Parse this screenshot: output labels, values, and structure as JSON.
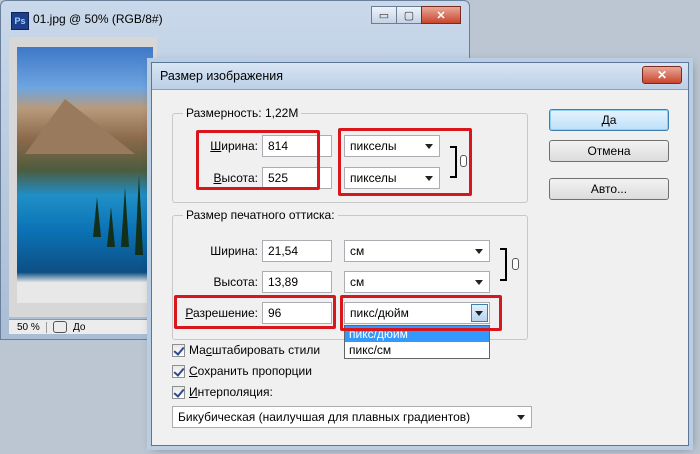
{
  "document_window": {
    "ps_icon": "Ps",
    "title": "01.jpg @ 50% (RGB/8#)",
    "buttons": {
      "minimize": "▭",
      "maximize": "▢",
      "close": "✕"
    },
    "status": {
      "zoom": "50 %",
      "doc_text": "До"
    }
  },
  "dialog": {
    "title": "Размер изображения",
    "close_label": "✕",
    "pixel_dimensions": {
      "prefix": "Размерность: ",
      "value": "1,22M",
      "width_label_u": "Ш",
      "width_label_rest": "ирина:",
      "width_value": "814",
      "width_unit": "пикселы",
      "height_label_u": "В",
      "height_label_rest": "ысота:",
      "height_value": "525",
      "height_unit": "пикселы"
    },
    "document_size": {
      "title": "Размер печатного оттиска:",
      "width_label": "Ширина:",
      "width_value": "21,54",
      "width_unit": "см",
      "height_label": "Высота:",
      "height_value": "13,89",
      "height_unit": "см",
      "resolution_label_u": "Р",
      "resolution_label_rest": "азрешение:",
      "resolution_value": "96",
      "resolution_unit": "пикс/дюйм",
      "resolution_options": [
        "пикс/дюйм",
        "пикс/см"
      ]
    },
    "buttons": {
      "ok": "Да",
      "cancel": "Отмена",
      "auto": "Авто..."
    },
    "checkboxes": [
      {
        "pre": "Ма",
        "u": "с",
        "post": "штабировать стили",
        "checked": true
      },
      {
        "pre": "",
        "u": "С",
        "post": "охранить пропорции",
        "checked": true
      },
      {
        "pre": "",
        "u": "И",
        "post": "нтерполяция:",
        "checked": true
      }
    ],
    "interpolation_method": "Бикубическая (наилучшая для плавных градиентов)"
  },
  "colors": {
    "highlight_box": "#d8161b",
    "selected_item": "#3399ff"
  }
}
